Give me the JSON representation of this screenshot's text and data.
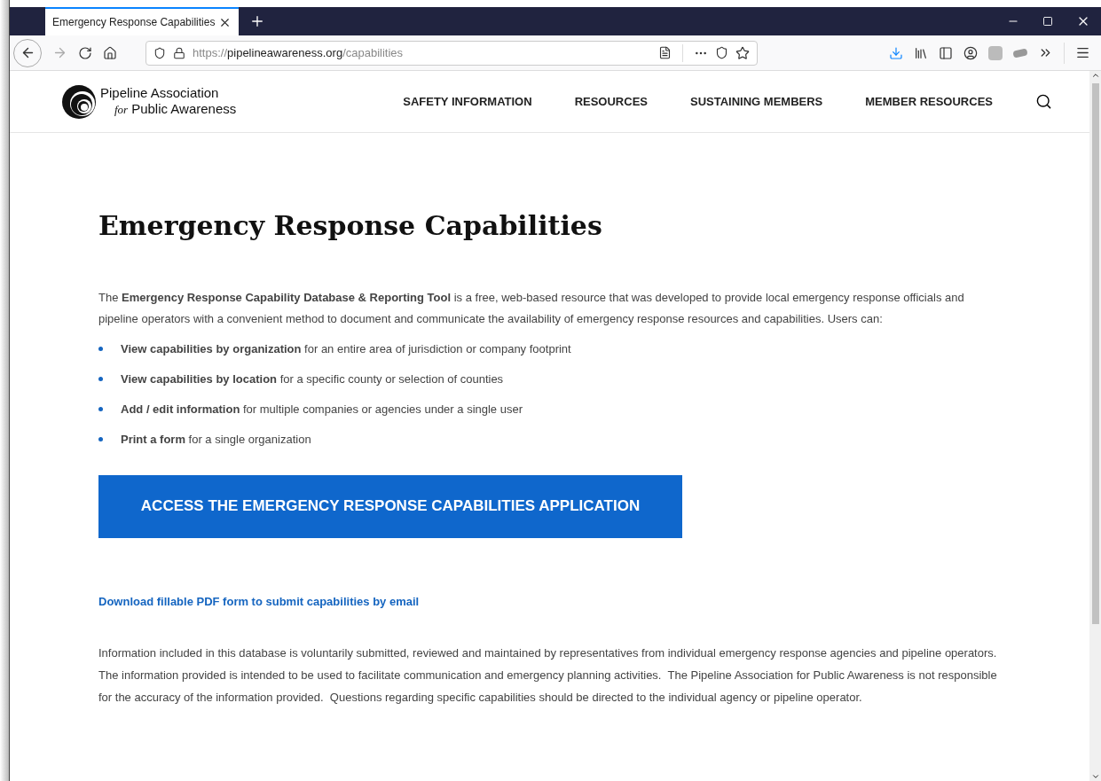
{
  "browser": {
    "tab": {
      "title": "Emergency Response Capabilities",
      "selected": true
    },
    "url": {
      "scheme": "https://",
      "host": "pipelineawareness.org",
      "path": "/capabilities"
    }
  },
  "site": {
    "logo": {
      "line_1": "Pipeline Association",
      "line_2_prefix": "for",
      "line_2": "Public Awareness"
    },
    "nav": [
      {
        "label": "SAFETY INFORMATION"
      },
      {
        "label": "RESOURCES"
      },
      {
        "label": "SUSTAINING MEMBERS"
      },
      {
        "label": "MEMBER RESOURCES"
      }
    ]
  },
  "page": {
    "title": "Emergency Response Capabilities",
    "intro": "The **Emergency Response Capability Database & Reporting Tool** is a free, web-based resource that was developed to provide local emergency response officials and pipeline operators with a convenient method to document and communicate the availability of emergency response resources and capabilities. Users can:",
    "bullets": [
      "**View capabilities by organization** for an entire area of jurisdiction or company footprint",
      "**View capabilities by location** for a specific county or selection of counties",
      "**Add / edit information** for multiple companies or agencies under a single user",
      "**Print a form** for a single organization"
    ],
    "cta_button": "ACCESS THE EMERGENCY RESPONSE CAPABILITIES APPLICATION",
    "download_link": "Download fillable PDF form to submit capabilities by email",
    "disclaimer": "Information included in this database is voluntarily submitted, reviewed and maintained by representatives from individual emergency response agencies and pipeline operators. The information provided is intended to be used to facilitate communication and emergency planning activities.  The Pipeline Association for Public Awareness is not responsible for the accuracy of the information provided.  Questions regarding specific capabilities should be directed to the individual agency or pipeline operator."
  }
}
